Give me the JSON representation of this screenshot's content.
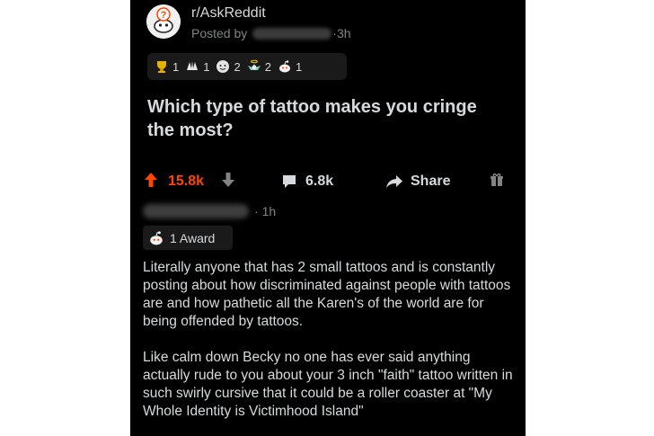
{
  "post": {
    "subreddit": "r/AskReddit",
    "posted_by_label": "Posted by",
    "age": "3h",
    "awards": [
      {
        "icon": "gold-cup-award-icon",
        "count": "1"
      },
      {
        "icon": "wholesome-hands-award-icon",
        "count": "1"
      },
      {
        "icon": "face-award-icon",
        "count": "2"
      },
      {
        "icon": "angel-award-icon",
        "count": "2"
      },
      {
        "icon": "snoo-award-icon",
        "count": "1"
      }
    ],
    "title": "Which type of tattoo makes you cringe the most?",
    "upvotes": "15.8k",
    "comments": "6.8k",
    "share_label": "Share"
  },
  "comment": {
    "age": "1h",
    "award_label": "1 Award",
    "paragraphs": [
      "Literally anyone that has 2 small tattoos and is constantly posting about how discriminated against people with tattoos are and how pathetic all the Karen's of the world are for being offended by tattoos.",
      "Like calm down Becky no one has ever said anything actually rude to you about your 3 inch \"faith\" tattoo written in such swirly cursive that it could be a roller coaster at \"My Whole Identity is Victimhood Island\""
    ]
  },
  "colors": {
    "background": "#000000",
    "text": "#d7dadc",
    "muted": "#818384",
    "upvote": "#ff4500",
    "award_bg": "#1a1a1b"
  }
}
